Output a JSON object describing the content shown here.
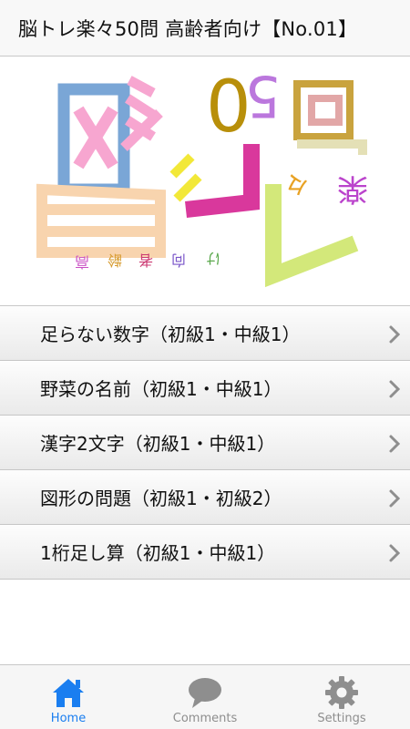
{
  "header": {
    "title": "脳トレ楽々50問 高齢者向け【No.01】"
  },
  "logo": {
    "name": "脳トレ楽々50問 高齢者向け",
    "subtitle_chars": [
      "高",
      "齢",
      "者",
      "向",
      "け"
    ],
    "chars": {
      "nou": "脳",
      "to": "ト",
      "re": "レ",
      "raku": "楽",
      "odoriji": "々",
      "five": "5",
      "zero": "0",
      "mon": "問"
    }
  },
  "menu": {
    "items": [
      {
        "label": "足らない数字（初級1・中級1）"
      },
      {
        "label": "野菜の名前（初級1・中級1）"
      },
      {
        "label": "漢字2文字（初級1・中級1）"
      },
      {
        "label": "図形の問題（初級1・初級2）"
      },
      {
        "label": "1桁足し算（初級1・中級1）"
      }
    ]
  },
  "tabbar": {
    "tabs": [
      {
        "label": "Home",
        "icon": "home-icon",
        "active": true
      },
      {
        "label": "Comments",
        "icon": "speech-bubble-icon",
        "active": false
      },
      {
        "label": "Settings",
        "icon": "gear-icon",
        "active": false
      }
    ]
  },
  "colors": {
    "accent": "#1a7ef0",
    "inactive": "#8e8e8e",
    "logo_blue": "#7aa6d6",
    "logo_pink": "#f7a6d0",
    "logo_peach": "#f8d4ae",
    "logo_olive": "#b88f0a",
    "logo_purple": "#bb77dd",
    "logo_magenta": "#d9389c",
    "logo_lime": "#d3e87a",
    "logo_yellow": "#f2e838"
  }
}
